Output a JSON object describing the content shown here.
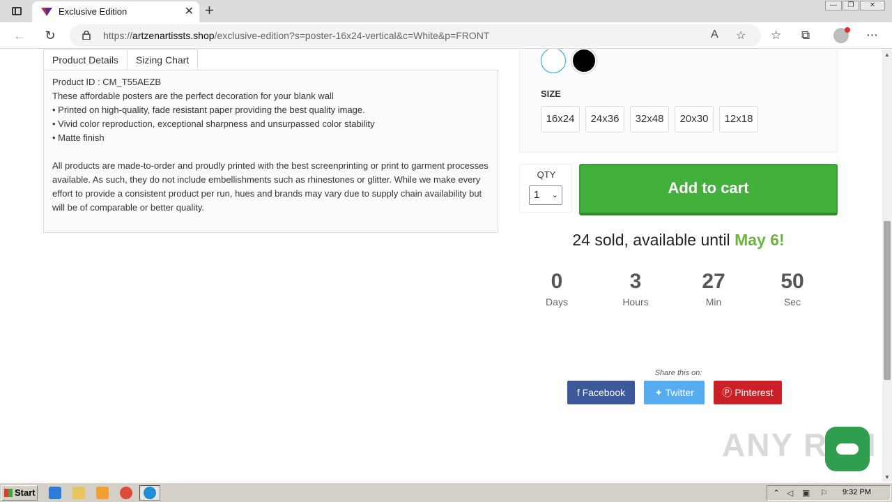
{
  "browser": {
    "tab_title": "Exclusive Edition",
    "url_prefix": "https://",
    "url_host": "artzenartissts.shop",
    "url_path": "/exclusive-edition?s=poster-16x24-vertical&c=White&p=FRONT"
  },
  "product_tabs": [
    "Product Details",
    "Sizing Chart"
  ],
  "details": {
    "product_id": "Product ID : CM_T55AEZB",
    "line1": "These affordable posters are the perfect decoration for your blank wall",
    "bullet1": "• Printed on high-quality, fade resistant paper providing the best quality image.",
    "bullet2": "• Vivid color reproduction, exceptional sharpness and unsurpassed color stability",
    "bullet3": "• Matte finish",
    "paragraph": "All products are made-to-order and proudly printed with the best screenprinting or print to garment processes available. As such, they do not include embellishments such as rhinestones or glitter. While we make every effort to provide a consistent product per run, hues and brands may vary due to supply chain availability but will be of comparable or better quality."
  },
  "colors": {
    "options": [
      "White",
      "Black"
    ],
    "selected": "White"
  },
  "size": {
    "title": "SIZE",
    "options": [
      "16x24",
      "24x36",
      "32x48",
      "20x30",
      "12x18"
    ]
  },
  "qty": {
    "label": "QTY",
    "value": "1"
  },
  "cart_button": "Add to cart",
  "sold": {
    "text": "24 sold, available until ",
    "date": "May 6!"
  },
  "countdown": [
    {
      "value": "0",
      "label": "Days"
    },
    {
      "value": "3",
      "label": "Hours"
    },
    {
      "value": "27",
      "label": "Min"
    },
    {
      "value": "50",
      "label": "Sec"
    }
  ],
  "share": {
    "label": "Share this on:",
    "facebook": "Facebook",
    "twitter": "Twitter",
    "pinterest": "Pinterest"
  },
  "watermark": "ANY RUN",
  "taskbar": {
    "start": "Start",
    "clock": "9:32 PM"
  },
  "accent_colors": {
    "cart": "#43b03c",
    "date": "#6cb33f",
    "facebook": "#3b5998",
    "twitter": "#55acee",
    "pinterest": "#cb2027"
  }
}
